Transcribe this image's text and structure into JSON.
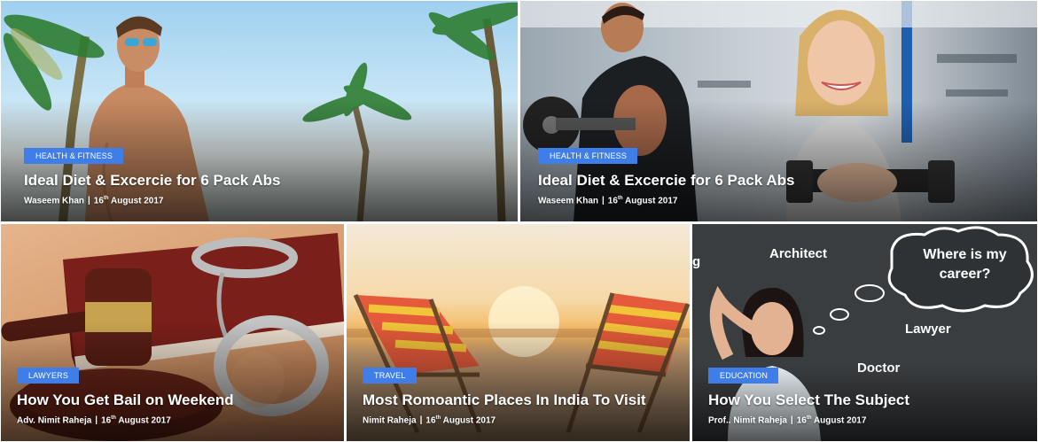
{
  "cards": [
    {
      "category": "HEALTH & FITNESS",
      "title": "Ideal Diet & Excercie for 6 Pack Abs",
      "author": "Waseem Khan",
      "date_day": "16",
      "date_suffix": "th",
      "date_rest": "August 2017",
      "separator": "|"
    },
    {
      "category": "HEALTH & FITNESS",
      "title": "Ideal Diet & Excercie for 6 Pack Abs",
      "author": "Waseem Khan",
      "date_day": "16",
      "date_suffix": "th",
      "date_rest": "August 2017",
      "separator": "|"
    },
    {
      "category": "LAWYERS",
      "title": "How You Get Bail on Weekend",
      "author": "Adv. Nimit Raheja",
      "date_day": "16",
      "date_suffix": "th",
      "date_rest": "August 2017",
      "separator": "|"
    },
    {
      "category": "TRAVEL",
      "title": "Most Romoantic Places In India To Visit",
      "author": "Nimit Raheja",
      "date_day": "16",
      "date_suffix": "th",
      "date_rest": "August 2017",
      "separator": "|"
    },
    {
      "category": "EDUCATION",
      "title": "How You Select The Subject",
      "author": "Prof.. Nimit Raheja",
      "date_day": "16",
      "date_suffix": "th",
      "date_rest": "August 2017",
      "separator": "|"
    }
  ],
  "chalkboard": {
    "bubble": "Where is my career?",
    "word_1": "Architect",
    "word_2": "Lawyer",
    "word_3": "Doctor",
    "word_4": "g"
  },
  "colors": {
    "badge": "#3f7ee8",
    "text": "#ffffff",
    "chalkboard": "#3a3d3f"
  }
}
